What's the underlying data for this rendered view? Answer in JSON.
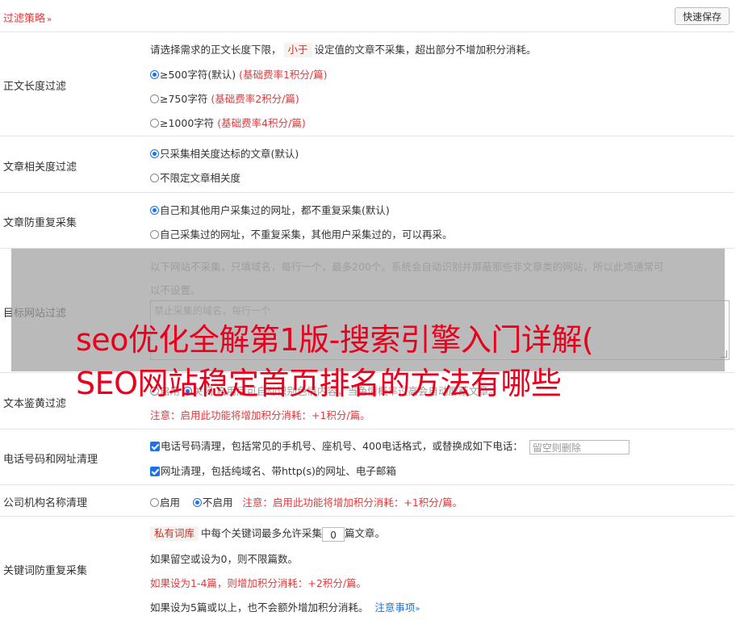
{
  "header": {
    "title": "过滤策略",
    "chevron": "»",
    "save_label": "快速保存"
  },
  "length_filter": {
    "label": "正文长度过滤",
    "desc_before": "请选择需求的正文长度下限，",
    "desc_tag": "小于",
    "desc_after": "设定值的文章不采集，超出部分不增加积分消耗。",
    "options": [
      {
        "text": "≥500字符(默认)",
        "note": "(基础费率1积分/篇)",
        "selected": true
      },
      {
        "text": "≥750字符",
        "note": "(基础费率2积分/篇)",
        "selected": false
      },
      {
        "text": "≥1000字符",
        "note": "(基础费率4积分/篇)",
        "selected": false
      }
    ]
  },
  "relevance": {
    "label": "文章相关度过滤",
    "options": [
      {
        "text": "只采集相关度达标的文章(默认)",
        "selected": true
      },
      {
        "text": "不限定文章相关度",
        "selected": false
      }
    ]
  },
  "dedupe": {
    "label": "文章防重复采集",
    "options": [
      {
        "text": "自己和其他用户采集过的网址，都不重复采集(默认)",
        "selected": true
      },
      {
        "text": "自己采集过的网址，不重复采集，其他用户采集过的，可以再采。",
        "selected": false
      }
    ]
  },
  "target_site": {
    "label": "目标网站过滤",
    "desc1": "以下网站不采集，只填域名，每行一个，最多200个。系统会自动识别并屏蔽那些非文章类的网站，所以此项通常可",
    "desc2": "以不设置。",
    "placeholder": "禁止采集的域名，每行一个"
  },
  "porn_filter": {
    "label": "文本鉴黄过滤",
    "line1_on": "启用",
    "line1_rest": "关闭  启用后可自动识别色情内容，当色情概率过高会自动屏蔽文章。",
    "note": "注意：启用此功能将增加积分消耗：+1积分/篇。"
  },
  "phone_clean": {
    "label": "电话号码和网址清理",
    "phone_text": "电话号码清理，包括常见的手机号、座机号、400电话格式，或替换成如下电话：",
    "phone_placeholder": "留空则删除",
    "url_text": "网址清理，包括纯域名、带http(s)的网址、电子邮箱"
  },
  "company": {
    "label": "公司机构名称清理",
    "on": "启用",
    "off": "不启用",
    "note": "注意：启用此功能将增加积分消耗：+1积分/篇。"
  },
  "keyword": {
    "label": "关键词防重复采集",
    "tag": "私有词库",
    "line1_mid": "中每个关键词最多允许采集",
    "line1_value": "0",
    "line1_end": "篇文章。",
    "line2": "如果留空或设为0，则不限篇数。",
    "line3": "如果设为1-4篇，则增加积分消耗：+2积分/篇。",
    "line4": "如果设为5篇或以上，也不会额外增加积分消耗。",
    "notice_link": "注意事项",
    "notice_chev": "»"
  },
  "overlay": {
    "line1": "seo优化全解第1版-搜索引擎入门详解(",
    "line2": "SEO网站稳定首页排名的方法有哪些"
  },
  "colors": {
    "accent": "#e4393c",
    "link": "#1a73e8",
    "overlay_text": "#e8001c"
  }
}
